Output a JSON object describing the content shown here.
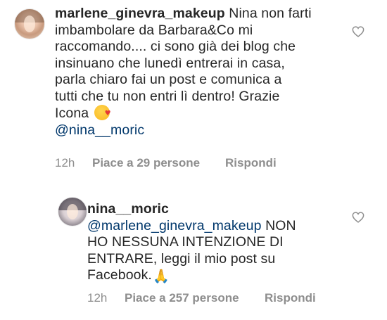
{
  "comments": [
    {
      "username": "marlene_ginevra_makeup",
      "lines": [
        " Nina non farti",
        "imbambolare da Barbara&Co mi",
        "raccomando.... ci sono già dei blog che",
        "insinuano che lunedì entrerai in casa,",
        "parla chiaro fai un post e comunica a",
        "tutti che tu non entri lì dentro! Grazie",
        "Icona "
      ],
      "emoji": "kiss-heart-face",
      "mention": "@nina__moric",
      "time": "12h",
      "likes": "Piace a 29 persone",
      "reply": "Rispondi",
      "like_icon": "heart-outline-icon"
    },
    {
      "username": "nina__moric",
      "mention": "@marlene_ginevra_makeup",
      "lines": [
        " NON",
        "HO NESSUNA INTENZIONE DI",
        "ENTRARE, leggi il mio post su",
        "Facebook."
      ],
      "emoji": "folded-hands",
      "time": "12h",
      "likes": "Piace a 257 persone",
      "reply": "Rispondi",
      "like_icon": "heart-outline-icon"
    }
  ],
  "colors": {
    "text": "#262626",
    "meta": "#8e8e8e",
    "mention": "#00376b",
    "background": "#ffffff"
  }
}
